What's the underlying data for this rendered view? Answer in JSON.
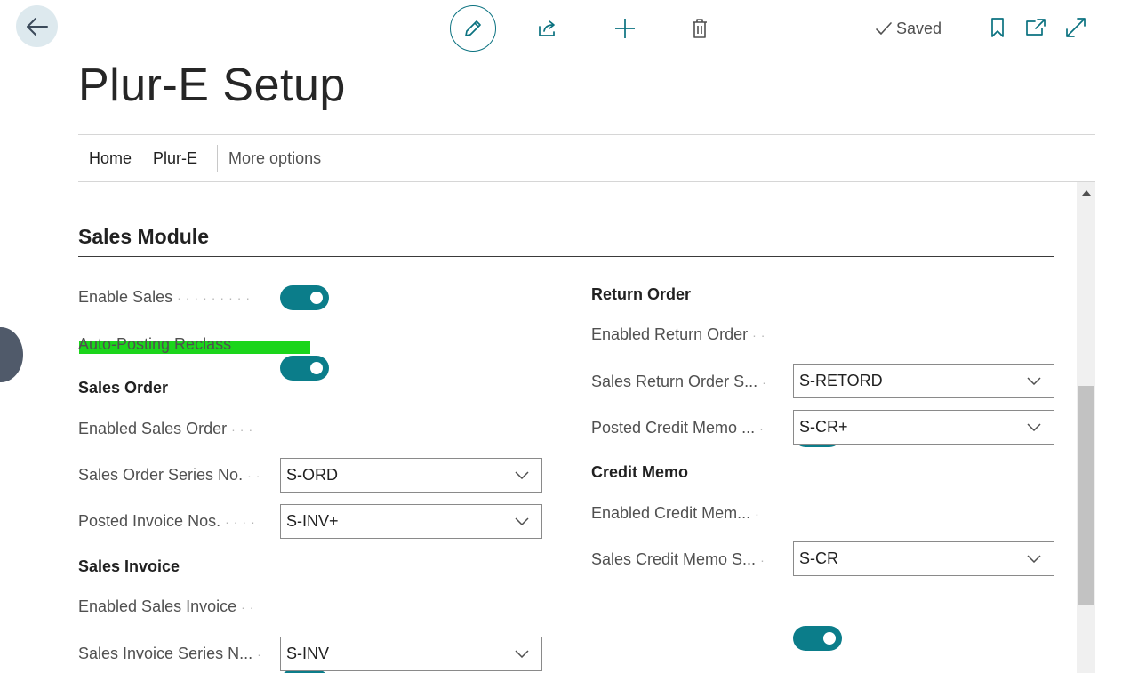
{
  "header": {
    "saved_label": "Saved",
    "icons": [
      "back-arrow-icon",
      "edit-icon",
      "share-icon",
      "add-icon",
      "delete-icon",
      "check-icon",
      "bookmark-icon",
      "open-new-window-icon",
      "expand-icon"
    ]
  },
  "page": {
    "title": "Plur-E Setup"
  },
  "nav": {
    "home": "Home",
    "plur_e": "Plur-E",
    "more": "More options"
  },
  "section": {
    "title": "Sales Module"
  },
  "left": {
    "enable_sales": {
      "label": "Enable Sales",
      "on": true
    },
    "auto_posting": {
      "label": "Auto-Posting Reclass",
      "on": true
    },
    "sales_order": {
      "title": "Sales Order",
      "enabled": {
        "label": "Enabled Sales Order",
        "on": true
      },
      "series": {
        "label": "Sales Order Series No.",
        "value": "S-ORD"
      },
      "posted": {
        "label": "Posted Invoice Nos.",
        "value": "S-INV+"
      }
    },
    "sales_invoice": {
      "title": "Sales Invoice",
      "enabled": {
        "label": "Enabled Sales Invoice",
        "on": true
      },
      "series": {
        "label": "Sales Invoice Series N...",
        "value": "S-INV"
      }
    }
  },
  "right": {
    "return_order": {
      "title": "Return Order",
      "enabled": {
        "label": "Enabled Return Order",
        "on": true
      },
      "series": {
        "label": "Sales Return Order S...",
        "value": "S-RETORD"
      },
      "posted": {
        "label": "Posted Credit Memo ...",
        "value": "S-CR+"
      }
    },
    "credit_memo": {
      "title": "Credit Memo",
      "enabled": {
        "label": "Enabled Credit Mem...",
        "on": true
      },
      "series": {
        "label": "Sales Credit Memo S...",
        "value": "S-CR"
      }
    }
  },
  "colors": {
    "accent": "#0b7d8a",
    "highlight": "#1bd51b"
  }
}
